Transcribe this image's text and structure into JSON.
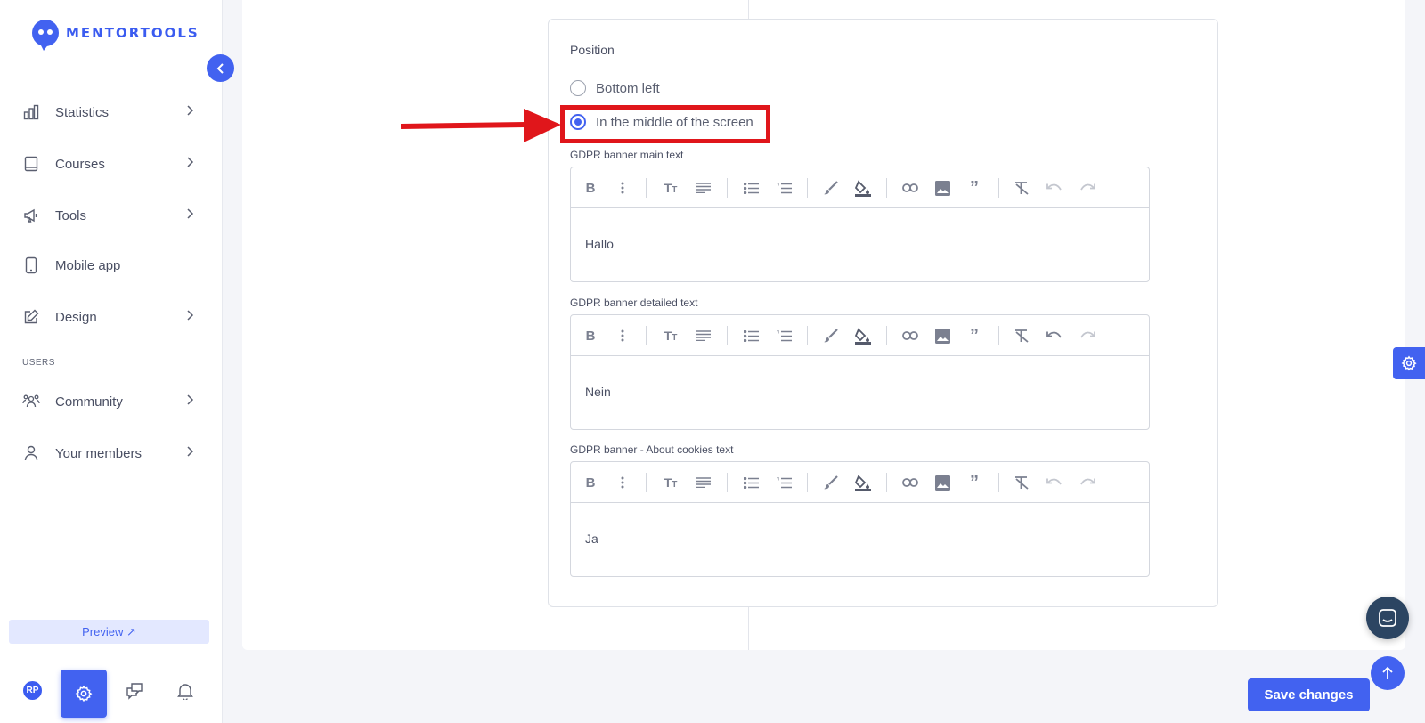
{
  "brand": {
    "name": "MENTORTOOLS",
    "accent": "#4262f0"
  },
  "sidebar": {
    "items": [
      {
        "label": "Statistics",
        "icon": "bar-chart-icon",
        "has_children": true
      },
      {
        "label": "Courses",
        "icon": "book-icon",
        "has_children": true
      },
      {
        "label": "Tools",
        "icon": "megaphone-icon",
        "has_children": true
      },
      {
        "label": "Mobile app",
        "icon": "phone-icon",
        "has_children": false
      },
      {
        "label": "Design",
        "icon": "pencil-square-icon",
        "has_children": true
      }
    ],
    "section_users": "USERS",
    "user_items": [
      {
        "label": "Community",
        "icon": "community-icon",
        "has_children": true
      },
      {
        "label": "Your members",
        "icon": "user-icon",
        "has_children": true
      }
    ],
    "preview_label": "Preview ↗",
    "avatar_initials": "RP"
  },
  "form": {
    "position_label": "Position",
    "options": [
      {
        "label": "Bottom left",
        "selected": false
      },
      {
        "label": "In the middle of the screen",
        "selected": true
      }
    ],
    "editors": [
      {
        "label": "GDPR banner main text",
        "content": "Hallo",
        "undo_enabled": false
      },
      {
        "label": "GDPR banner detailed text",
        "content": "Nein",
        "undo_enabled": true
      },
      {
        "label": "GDPR banner - About cookies text",
        "content": "Ja",
        "undo_enabled": false
      }
    ]
  },
  "footer": {
    "save_label": "Save changes"
  },
  "annotation_color": "#e0161b"
}
